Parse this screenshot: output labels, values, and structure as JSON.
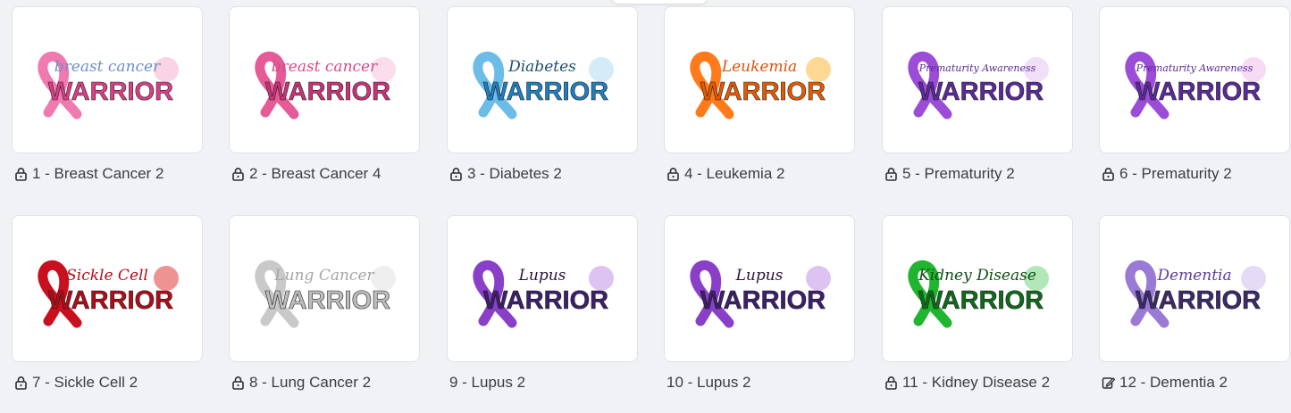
{
  "items": [
    {
      "title": "1 - Breast Cancer 2",
      "icon": "lock-icon",
      "thumb": {
        "script": "breast cancer",
        "main": "WARRIOR",
        "ribbon": "#f07ab0",
        "text_color": "#d93f86",
        "script_color": "#6e8fc9",
        "accent": "#f7b6d3"
      }
    },
    {
      "title": "2 - Breast Cancer 4",
      "icon": "lock-icon",
      "thumb": {
        "script": "breast cancer",
        "main": "WARRIOR",
        "ribbon": "#e65a98",
        "text_color": "#c93277",
        "script_color": "#d54b89",
        "accent": "#f9c7de"
      }
    },
    {
      "title": "3 - Diabetes 2",
      "icon": "lock-icon",
      "thumb": {
        "script": "Diabetes",
        "main": "WARRIOR",
        "ribbon": "#6bbde8",
        "text_color": "#1f7fbf",
        "script_color": "#1d4f74",
        "accent": "#b7ddf3"
      }
    },
    {
      "title": "4 - Leukemia 2",
      "icon": "lock-icon",
      "thumb": {
        "script": "Leukemia",
        "main": "WARRIOR",
        "ribbon": "#ff7a1a",
        "text_color": "#e55a00",
        "script_color": "#d9530a",
        "accent": "#ffc04d"
      }
    },
    {
      "title": "5 - Prematurity 2",
      "icon": "lock-icon",
      "thumb": {
        "script": "Prematurity Awareness",
        "main": "WARRIOR",
        "ribbon": "#9b4dd8",
        "text_color": "#5a2a99",
        "script_color": "#5a2a99",
        "accent": "#e7c9f7"
      }
    },
    {
      "title": "6 - Prematurity 2",
      "icon": "lock-icon",
      "thumb": {
        "script": "Prematurity Awareness",
        "main": "WARRIOR",
        "ribbon": "#9b4dd8",
        "text_color": "#5a2a99",
        "script_color": "#5a2a99",
        "accent": "#f1c3ee"
      }
    },
    {
      "title": "7 - Sickle Cell 2",
      "icon": "lock-icon",
      "thumb": {
        "script": "Sickle Cell",
        "main": "WARRIOR",
        "ribbon": "#c8101e",
        "text_color": "#b00d18",
        "script_color": "#b00d18",
        "accent": "#e54a4a"
      }
    },
    {
      "title": "8 - Lung Cancer 2",
      "icon": "lock-icon",
      "thumb": {
        "script": "Lung Cancer",
        "main": "WARRIOR",
        "ribbon": "#c9c9c9",
        "text_color": "#bdbdbd",
        "script_color": "#a6a6a6",
        "accent": "#e5e5e5"
      }
    },
    {
      "title": "9 - Lupus 2",
      "icon": "",
      "thumb": {
        "script": "Lupus",
        "main": "WARRIOR",
        "ribbon": "#8a3fc9",
        "text_color": "#3d1f6b",
        "script_color": "#2a143f",
        "accent": "#c69bea"
      }
    },
    {
      "title": "10 - Lupus 2",
      "icon": "",
      "thumb": {
        "script": "Lupus",
        "main": "WARRIOR",
        "ribbon": "#8a3fc9",
        "text_color": "#3d1f6b",
        "script_color": "#2a143f",
        "accent": "#c69bea"
      }
    },
    {
      "title": "11 - Kidney Disease 2",
      "icon": "lock-icon",
      "thumb": {
        "script": "Kidney Disease",
        "main": "WARRIOR",
        "ribbon": "#1fb52f",
        "text_color": "#0f6b1b",
        "script_color": "#0f4f17",
        "accent": "#7fd88a"
      }
    },
    {
      "title": "12 - Dementia 2",
      "icon": "edit-icon",
      "thumb": {
        "script": "Dementia",
        "main": "WARRIOR",
        "ribbon": "#9b7ad6",
        "text_color": "#3d2a6b",
        "script_color": "#5a3f9e",
        "accent": "#d4c3f0"
      }
    }
  ]
}
